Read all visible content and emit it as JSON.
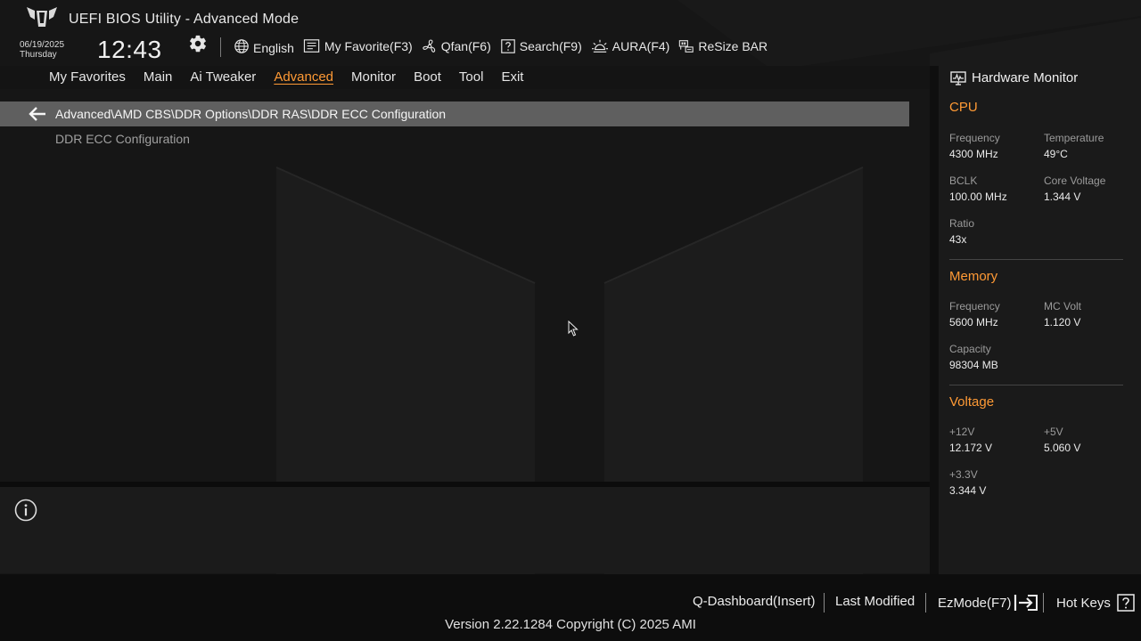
{
  "header": {
    "app_title": "UEFI BIOS Utility - Advanced Mode",
    "date": "06/19/2025",
    "weekday": "Thursday",
    "time": "12:43",
    "logo_icon": "tuf-logo-icon",
    "settings_icon": "gear-icon"
  },
  "toolbar": {
    "language": "English",
    "favorite": "My Favorite(F3)",
    "qfan": "Qfan(F6)",
    "search": "Search(F9)",
    "aura": "AURA(F4)",
    "resize_bar": "ReSize BAR"
  },
  "nav": {
    "tabs": [
      "My Favorites",
      "Main",
      "Ai Tweaker",
      "Advanced",
      "Monitor",
      "Boot",
      "Tool",
      "Exit"
    ],
    "active": "Advanced"
  },
  "breadcrumb": {
    "path": "Advanced\\AMD CBS\\DDR Options\\DDR RAS\\DDR ECC Configuration"
  },
  "menu": {
    "items": [
      "DDR ECC Configuration"
    ]
  },
  "hardware_monitor": {
    "title": "Hardware Monitor",
    "cpu": {
      "title": "CPU",
      "frequency_label": "Frequency",
      "frequency": "4300 MHz",
      "temperature_label": "Temperature",
      "temperature": "49°C",
      "bclk_label": "BCLK",
      "bclk": "100.00 MHz",
      "core_voltage_label": "Core Voltage",
      "core_voltage": "1.344 V",
      "ratio_label": "Ratio",
      "ratio": "43x"
    },
    "memory": {
      "title": "Memory",
      "frequency_label": "Frequency",
      "frequency": "5600 MHz",
      "mc_volt_label": "MC Volt",
      "mc_volt": "1.120 V",
      "capacity_label": "Capacity",
      "capacity": "98304 MB"
    },
    "voltage": {
      "title": "Voltage",
      "v12_label": "+12V",
      "v12": "12.172 V",
      "v5_label": "+5V",
      "v5": "5.060 V",
      "v33_label": "+3.3V",
      "v33": "3.344 V"
    }
  },
  "footer": {
    "q_dashboard": "Q-Dashboard(Insert)",
    "last_modified": "Last Modified",
    "ezmode": "EzMode(F7)",
    "hot_keys": "Hot Keys",
    "version": "Version 2.22.1284 Copyright (C) 2025 AMI"
  },
  "colors": {
    "accent": "#ff9a35",
    "background": "#161616",
    "breadcrumb_bar": "#5f5f5f"
  }
}
